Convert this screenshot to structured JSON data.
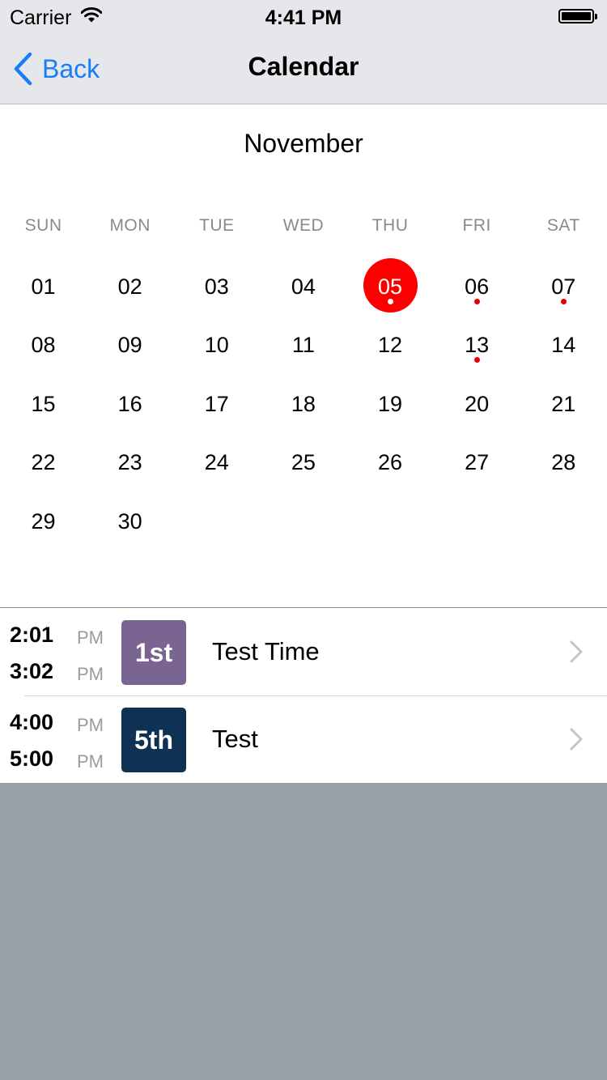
{
  "status_bar": {
    "carrier": "Carrier",
    "time": "4:41 PM"
  },
  "nav": {
    "back_label": "Back",
    "title": "Calendar"
  },
  "calendar": {
    "month": "November",
    "weekdays": [
      "SUN",
      "MON",
      "TUE",
      "WED",
      "THU",
      "FRI",
      "SAT"
    ],
    "leading_blank_days": 0,
    "days": [
      "01",
      "02",
      "03",
      "04",
      "05",
      "06",
      "07",
      "08",
      "09",
      "10",
      "11",
      "12",
      "13",
      "14",
      "15",
      "16",
      "17",
      "18",
      "19",
      "20",
      "21",
      "22",
      "23",
      "24",
      "25",
      "26",
      "27",
      "28",
      "29",
      "30"
    ],
    "selected_day": "05",
    "days_with_events": [
      "05",
      "06",
      "07",
      "13"
    ],
    "selected_color": "#fc0000",
    "event_dot_color": "#e50000"
  },
  "events": [
    {
      "start": "2:01",
      "start_ampm": "PM",
      "end": "3:02",
      "end_ampm": "PM",
      "badge": "1st",
      "badge_color": "#7a6492",
      "title": "Test Time",
      "chevron_icon": "chevron-right-icon"
    },
    {
      "start": "4:00",
      "start_ampm": "PM",
      "end": "5:00",
      "end_ampm": "PM",
      "badge": "5th",
      "badge_color": "#0f3154",
      "title": "Test",
      "chevron_icon": "chevron-right-icon"
    }
  ],
  "colors": {
    "accent": "#1a7cf6",
    "empty_area": "#98a0aa"
  }
}
